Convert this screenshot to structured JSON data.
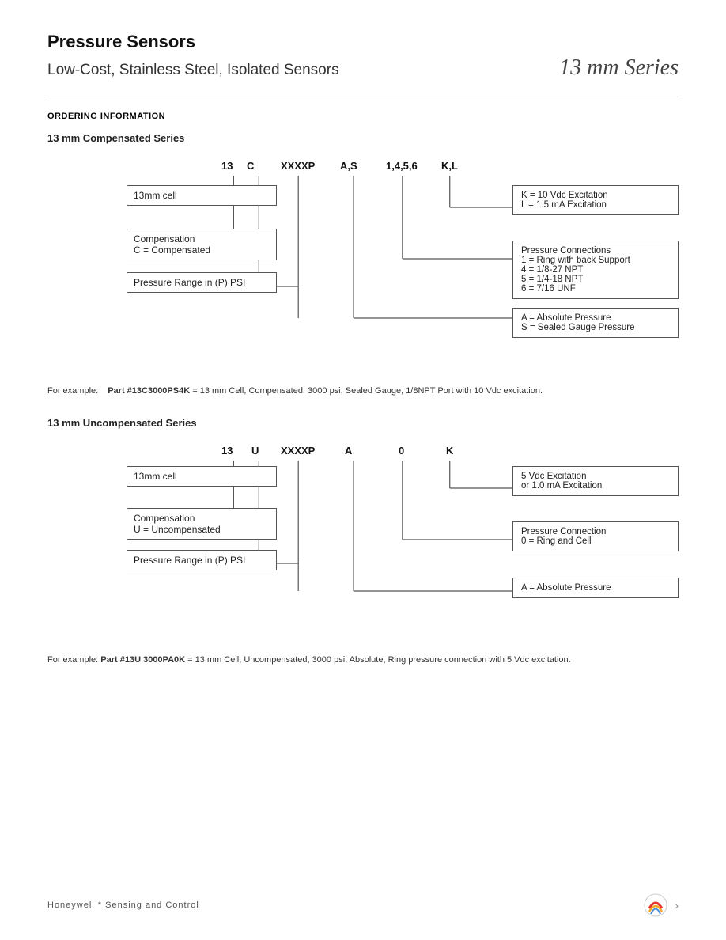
{
  "header": {
    "title": "Pressure Sensors",
    "subtitle": "Low-Cost, Stainless Steel, Isolated Sensors",
    "series": "13 mm Series"
  },
  "ordering": {
    "label": "ORDERING INFORMATION"
  },
  "compensated": {
    "title": "13 mm Compensated Series",
    "codes": {
      "c1": "13",
      "c2": "C",
      "c3": "XXXXP",
      "c4": "A,S",
      "c5": "1,4,5,6",
      "c6": "K,L"
    },
    "boxes": {
      "cell": "13mm cell",
      "compensation_line1": "Compensation",
      "compensation_line2": "C = Compensated",
      "pressure_range": "Pressure Range in (P) PSI"
    },
    "right_boxes": {
      "excitation_line1": "K = 10 Vdc Excitation",
      "excitation_line2": "L = 1.5 mA Excitation",
      "pressure_conn_title": "Pressure Connections",
      "pressure_conn_1": "1 = Ring with back Support",
      "pressure_conn_4": "4 = 1/8-27 NPT",
      "pressure_conn_5": "5 = 1/4-18 NPT",
      "pressure_conn_6": "6 = 7/16 UNF",
      "pressure_type_A": "A = Absolute Pressure",
      "pressure_type_S": "S = Sealed Gauge Pressure"
    },
    "example_prefix": "For example:",
    "example_part": "Part #13C3000PS4K",
    "example_suffix": " = 13 mm Cell, Compensated, 3000 psi, Sealed Gauge, 1/8NPT Port with 10 Vdc excitation."
  },
  "uncompensated": {
    "title": "13 mm Uncompensated Series",
    "codes": {
      "c1": "13",
      "c2": "U",
      "c3": "XXXXP",
      "c4": "A",
      "c5": "0",
      "c6": "K"
    },
    "boxes": {
      "cell": "13mm cell",
      "compensation_line1": "Compensation",
      "compensation_line2": "U = Uncompensated",
      "pressure_range": "Pressure Range in (P) PSI"
    },
    "right_boxes": {
      "excitation_line1": "5 Vdc Excitation",
      "excitation_line2": "or 1.0  mA Excitation",
      "pressure_conn_title": "Pressure Connection",
      "pressure_conn_0": "0 = Ring and Cell",
      "pressure_type_A": "A = Absolute Pressure"
    },
    "example_prefix": "For example:",
    "example_part": "Part #13U 3000PA0K",
    "example_suffix": " = 13 mm Cell, Uncompensated, 3000 psi, Absolute, Ring pressure connection with 5 Vdc excitation."
  },
  "footer": {
    "text": "Honeywell   *   Sensing    and    Control"
  }
}
